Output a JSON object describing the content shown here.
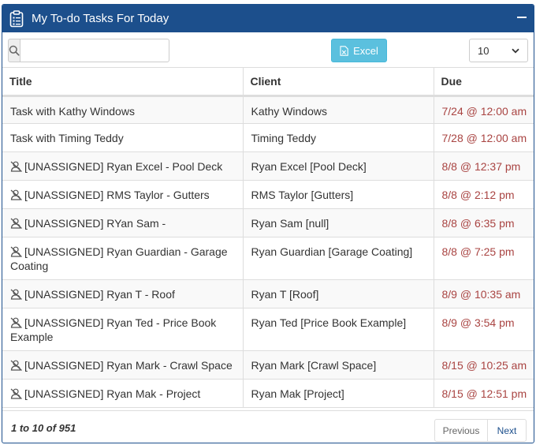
{
  "panel": {
    "title": "My To-do Tasks For Today"
  },
  "toolbar": {
    "search_value": "",
    "search_placeholder": "",
    "excel_label": "Excel",
    "page_length": "10"
  },
  "table": {
    "columns": [
      "Title",
      "Client",
      "Due"
    ],
    "rows": [
      {
        "icon": "",
        "title": "Task with Kathy Windows",
        "client": "Kathy Windows",
        "due": "7/24 @ 12:00 am"
      },
      {
        "icon": "",
        "title": "Task with Timing Teddy",
        "client": "Timing Teddy",
        "due": "7/28 @ 12:00 am"
      },
      {
        "icon": "user-off-icon",
        "title": "[UNASSIGNED] Ryan Excel - Pool Deck",
        "client": "Ryan Excel [Pool Deck]",
        "due": "8/8 @ 12:37 pm"
      },
      {
        "icon": "user-off-icon",
        "title": "[UNASSIGNED] RMS Taylor - Gutters",
        "client": "RMS Taylor [Gutters]",
        "due": "8/8 @ 2:12 pm"
      },
      {
        "icon": "user-off-icon",
        "title": "[UNASSIGNED] RYan Sam -",
        "client": "Ryan Sam [null]",
        "due": "8/8 @ 6:35 pm"
      },
      {
        "icon": "user-off-icon",
        "title": "[UNASSIGNED] Ryan Guardian - Garage Coating",
        "client": "Ryan Guardian [Garage Coating]",
        "due": "8/8 @ 7:25 pm"
      },
      {
        "icon": "user-off-icon",
        "title": "[UNASSIGNED] Ryan T - Roof",
        "client": "Ryan T [Roof]",
        "due": "8/9 @ 10:35 am"
      },
      {
        "icon": "user-off-icon",
        "title": "[UNASSIGNED] Ryan Ted - Price Book Example",
        "client": "Ryan Ted [Price Book Example]",
        "due": "8/9 @ 3:54 pm"
      },
      {
        "icon": "user-off-icon",
        "title": "[UNASSIGNED] Ryan Mark - Crawl Space",
        "client": "Ryan Mark [Crawl Space]",
        "due": "8/15 @ 10:25 am"
      },
      {
        "icon": "user-off-icon",
        "title": "[UNASSIGNED] Ryan Mak - Project",
        "client": "Ryan Mak [Project]",
        "due": "8/15 @ 12:51 pm"
      }
    ]
  },
  "footer": {
    "info": "1 to 10 of 951",
    "previous_label": "Previous",
    "next_label": "Next"
  },
  "colors": {
    "header_bg": "#1c4f8c",
    "excel_button": "#5bc0de",
    "due_text": "#a94442"
  }
}
